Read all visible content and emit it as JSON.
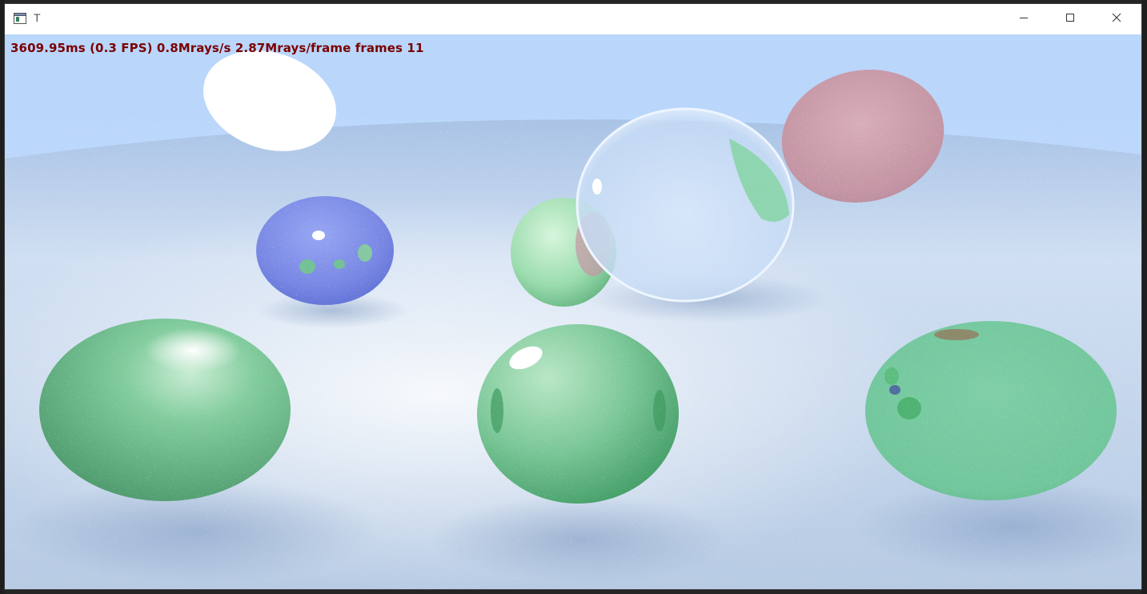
{
  "window": {
    "title": "T",
    "minimize_glyph": "—",
    "maximize_glyph": "□",
    "close_glyph": "✕"
  },
  "overlay": {
    "stats_text": "3609.95ms (0.3 FPS) 0.8Mrays/s 2.87Mrays/frame frames 11"
  },
  "colors": {
    "sky": "#bcd8fb",
    "floor": "#c9d8ec",
    "stats_text": "#7a0000",
    "green_sphere": "#7cc79c",
    "blue_sphere": "#7d8ee6",
    "pink_sphere": "#c79aa7",
    "light": "#ffffff"
  },
  "icons": [
    "app-window-icon",
    "minimize-icon",
    "maximize-icon",
    "close-icon"
  ]
}
